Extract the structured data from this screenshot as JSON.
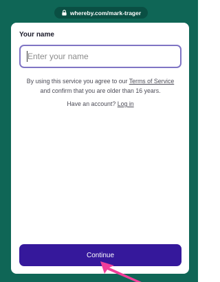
{
  "browser": {
    "url": "whereby.com/mark-trager",
    "lock_icon": "lock-icon"
  },
  "colors": {
    "frame_background": "#0f6656",
    "url_pill": "#0a4f43",
    "input_border": "#7f74c4",
    "primary_button": "#35189b",
    "pointer_arrow": "#f03e9a"
  },
  "form": {
    "name_label": "Your name",
    "name_input_placeholder": "Enter your name",
    "name_input_value": "",
    "terms_prefix": "By using this service you agree to our",
    "terms_link": "Terms of Service",
    "terms_suffix": "and confirm that you are older than 16 years.",
    "account_prompt": "Have an account?",
    "login_link": "Log in",
    "continue_label": "Continue"
  },
  "annotation": {
    "pointer_icon": "pointer-arrow-icon"
  }
}
